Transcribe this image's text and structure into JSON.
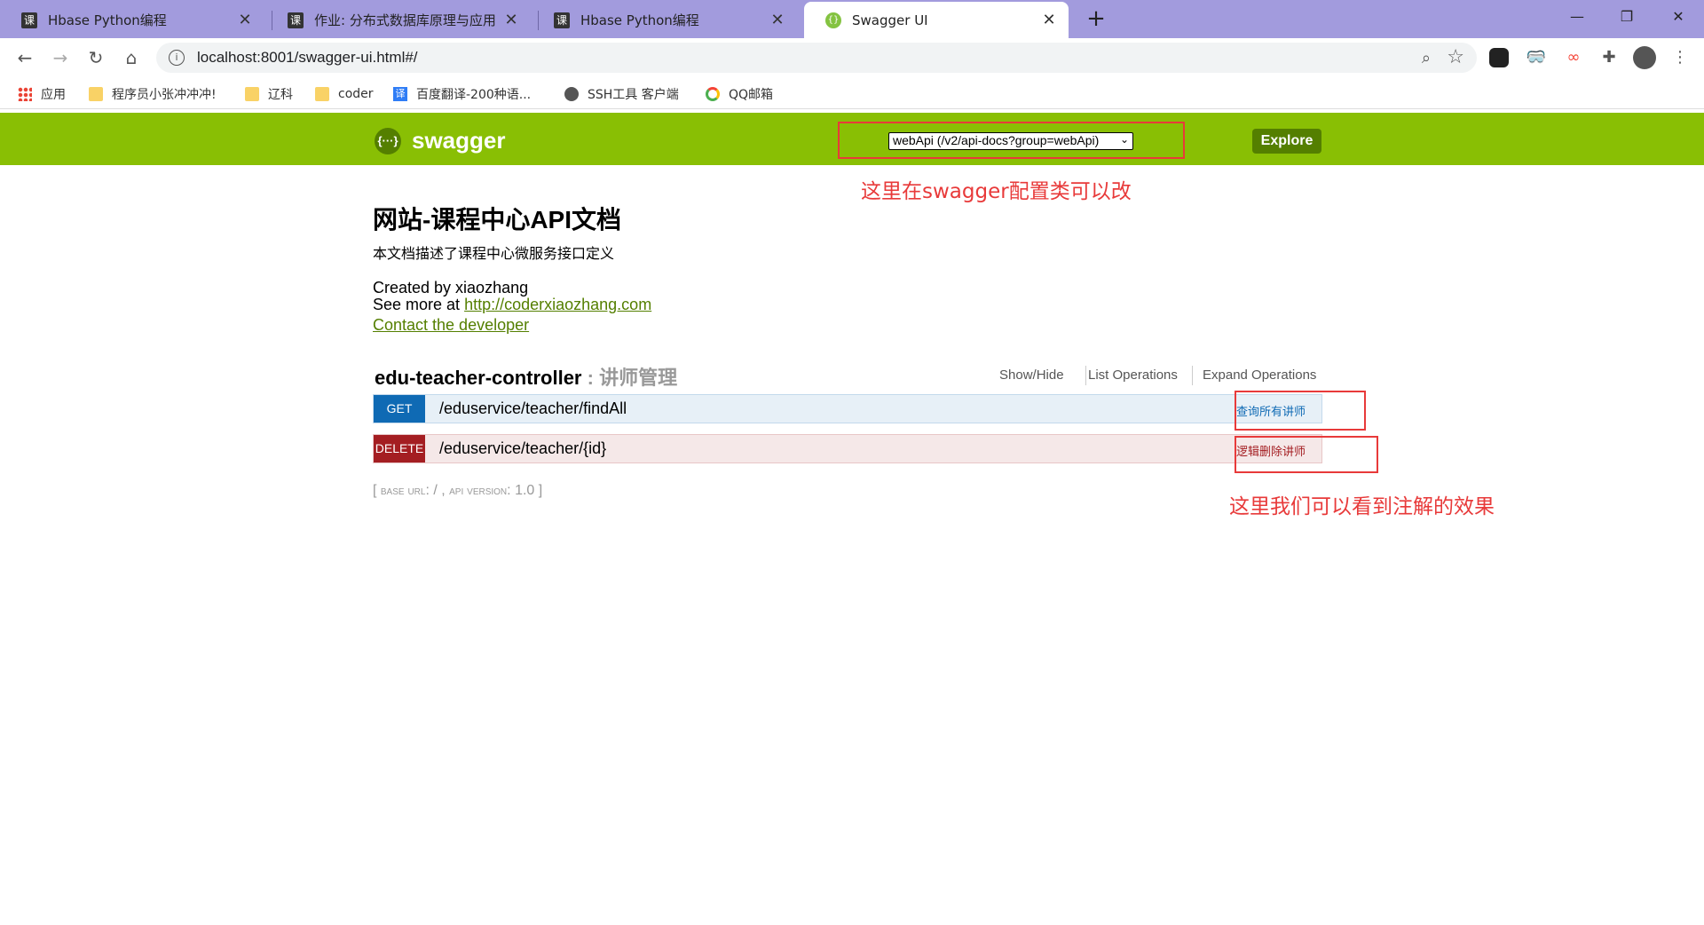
{
  "browser": {
    "tabs": [
      {
        "title": "Hbase Python编程",
        "icon": "课"
      },
      {
        "title": "作业: 分布式数据库原理与应用",
        "icon": "课"
      },
      {
        "title": "Hbase Python编程",
        "icon": "课"
      },
      {
        "title": "Swagger UI",
        "icon": "swagger-icon"
      }
    ],
    "url": "localhost:8001/swagger-ui.html#/",
    "bookmarks": [
      {
        "label": "应用"
      },
      {
        "label": "程序员小张冲冲冲!"
      },
      {
        "label": "辽科"
      },
      {
        "label": "coder"
      },
      {
        "label": "百度翻译-200种语..."
      },
      {
        "label": "SSH工具 客户端"
      },
      {
        "label": "QQ邮箱"
      }
    ]
  },
  "swagger": {
    "logo_text": "swagger",
    "logo_glyph": "{···}",
    "select_value": "webApi (/v2/api-docs?group=webApi)",
    "explore_label": "Explore",
    "title": "网站-课程中心API文档",
    "description": "本文档描述了课程中心微服务接口定义",
    "created_by": "Created by xiaozhang",
    "see_more_prefix": "See more at ",
    "see_more_link": "http://coderxiaozhang.com",
    "contact": "Contact the developer",
    "controller": {
      "name": "edu-teacher-controller",
      "separator": " : ",
      "description": "讲师管理",
      "show_hide": "Show/Hide",
      "list_ops": "List Operations",
      "expand_ops": "Expand Operations"
    },
    "operations": [
      {
        "method": "GET",
        "path": "/eduservice/teacher/findAll",
        "summary": "查询所有讲师"
      },
      {
        "method": "DELETE",
        "path": "/eduservice/teacher/{id}",
        "summary": "逻辑删除讲师"
      }
    ],
    "base_url_open": "[ ",
    "base_url_label": "base url",
    "base_url_value": ": / , ",
    "api_version_label": "api version",
    "api_version_value": ": 1.0 ]"
  },
  "annotations": {
    "note1": "这里在swagger配置类可以改",
    "note2": "这里我们可以看到注解的效果"
  },
  "colors": {
    "tab_strip": "#a29bdd",
    "swagger_green": "#89bf04",
    "get_blue": "#0f6ab4",
    "delete_red": "#a41e22",
    "annotation_red": "#e83a3a"
  }
}
